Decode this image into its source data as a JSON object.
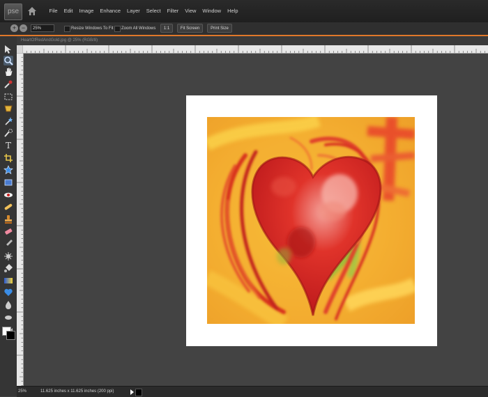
{
  "app": {
    "logo_text": "pse"
  },
  "menu": [
    "File",
    "Edit",
    "Image",
    "Enhance",
    "Layer",
    "Select",
    "Filter",
    "View",
    "Window",
    "Help"
  ],
  "options_bar": {
    "zoom_value": "25%",
    "resize_windows_label": "Resize Windows To Fit",
    "zoom_all_windows_label": "Zoom All Windows",
    "actual_pixels_label": "1:1",
    "fit_screen_label": "Fit Screen",
    "print_size_label": "Print Size"
  },
  "document": {
    "tab_title": "HeartOfRedAndGold.jpg @ 25% (RGB/8)"
  },
  "status": {
    "zoom": "25%",
    "info": "11.625 inches x 11.625 inches (200 ppi)"
  },
  "colors": {
    "accent": "#e0782a",
    "foreground": "#ffffff",
    "background": "#000000"
  },
  "icons": {
    "tools": [
      "move-icon",
      "zoom-icon",
      "hand-icon",
      "eyedropper-icon",
      "marquee-icon",
      "lasso-icon",
      "magic-wand-icon",
      "quick-selection-icon",
      "type-icon",
      "crop-icon",
      "cookie-cutter-icon",
      "straighten-icon",
      "red-eye-icon",
      "spot-healing-icon",
      "clone-stamp-icon",
      "eraser-icon",
      "brush-icon",
      "smart-brush-icon",
      "paint-bucket-icon",
      "gradient-icon",
      "custom-shape-icon",
      "blur-icon",
      "sponge-icon",
      "pencil-icon"
    ]
  }
}
